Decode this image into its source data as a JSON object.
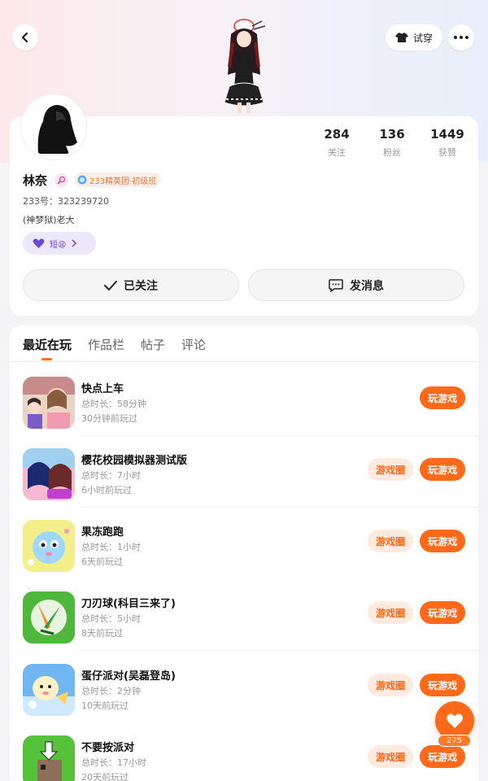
{
  "header": {
    "tryon_label": "试穿"
  },
  "profile": {
    "username": "林奈",
    "level_badge": "233精英团·初级班",
    "uid_line": "233号：323239720",
    "bio": "(神梦狱)老大",
    "tag_chip": "短😩",
    "stats": [
      {
        "value": "284",
        "label": "关注"
      },
      {
        "value": "136",
        "label": "粉丝"
      },
      {
        "value": "1449",
        "label": "获赞"
      }
    ],
    "follow_label": "已关注",
    "message_label": "发消息"
  },
  "tabs": [
    "最近在玩",
    "作品栏",
    "帖子",
    "评论"
  ],
  "active_tab": "最近在玩",
  "games": [
    {
      "title": "快点上车",
      "duration": "总时长：58分钟",
      "last_played": "30分钟前玩过",
      "has_circle": false
    },
    {
      "title": "樱花校园模拟器测试版",
      "duration": "总时长：7小时",
      "last_played": "6小时前玩过",
      "has_circle": true
    },
    {
      "title": "果冻跑跑",
      "duration": "总时长：1小时",
      "last_played": "6天前玩过",
      "has_circle": true
    },
    {
      "title": "刀刃球(科目三来了)",
      "duration": "总时长：5小时",
      "last_played": "8天前玩过",
      "has_circle": true
    },
    {
      "title": "蛋仔派对(吴磊登岛)",
      "duration": "总时长：2分钟",
      "last_played": "10天前玩过",
      "has_circle": true
    },
    {
      "title": "不要按派对",
      "duration": "总时长：17小时",
      "last_played": "20天前玩过",
      "has_circle": true
    }
  ],
  "buttons": {
    "play_label": "玩游戏",
    "circle_label": "游戏圈"
  },
  "like": {
    "count": "275"
  },
  "colors": {
    "accent": "#ff6a1a",
    "accent_soft": "#ffeadf",
    "tag_purple": "#6a4ad2"
  }
}
